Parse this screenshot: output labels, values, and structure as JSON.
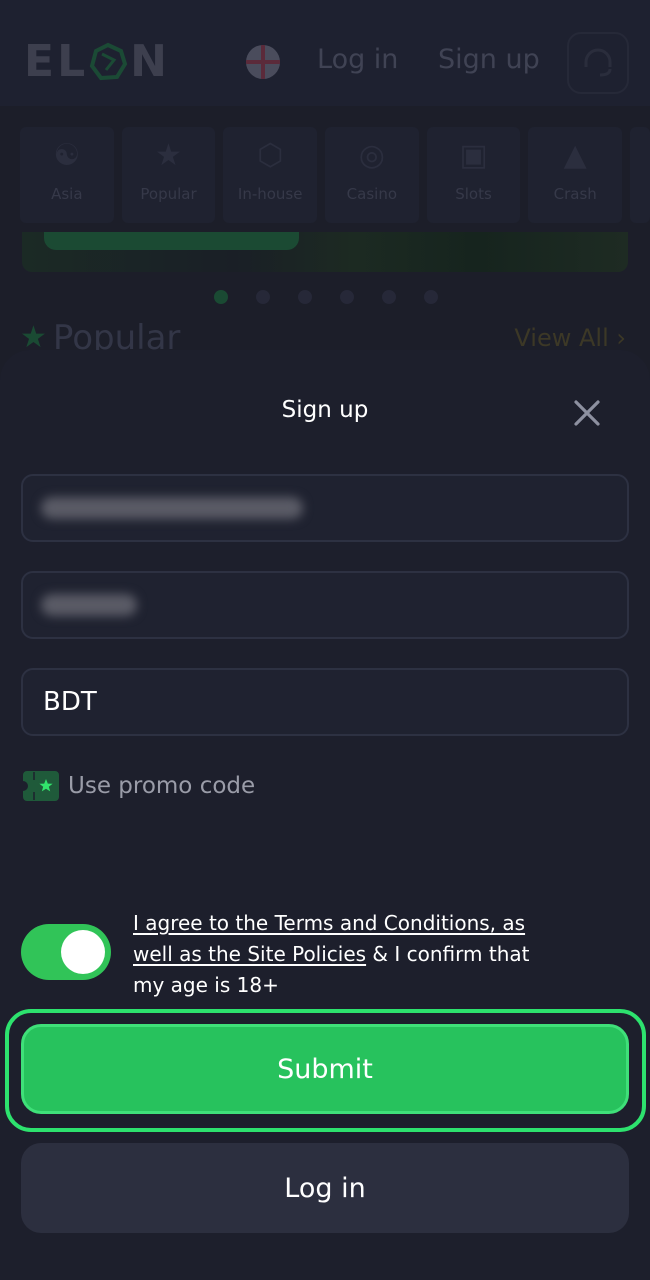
{
  "header": {
    "logo_text": [
      "E",
      "L",
      "N"
    ],
    "brand": "ELON",
    "language_flag": "england-flag-icon",
    "login_label": "Log in",
    "signup_label": "Sign up",
    "support_icon": "headset-icon"
  },
  "categories": [
    {
      "label": "Asia",
      "icon": "yin-yang-icon"
    },
    {
      "label": "Popular",
      "icon": "star-icon"
    },
    {
      "label": "In-house",
      "icon": "elon-logo-icon"
    },
    {
      "label": "Casino",
      "icon": "roulette-icon"
    },
    {
      "label": "Slots",
      "icon": "slot-machine-icon"
    },
    {
      "label": "Crash",
      "icon": "rocket-icon"
    }
  ],
  "carousel": {
    "slides": 6,
    "active_index": 0
  },
  "popular_section": {
    "title": "Popular",
    "view_all_label": "View All"
  },
  "signup_sheet": {
    "title": "Sign up",
    "email_value": "[blurred email]",
    "password_value": "[blurred password]",
    "currency_value": "BDT",
    "promo_label": "Use promo code",
    "agree_toggle_on": true,
    "agree_link": "I agree to the Terms and Conditions, as well as the Site Policies",
    "agree_rest": " & I confirm that my age is 18+",
    "submit_label": "Submit",
    "login_label": "Log in"
  },
  "colors": {
    "accent_green": "#27c25d",
    "focus_ring": "#2de26e",
    "sheet_bg": "#1d1f2c",
    "secondary_button": "#2c2f3f"
  }
}
